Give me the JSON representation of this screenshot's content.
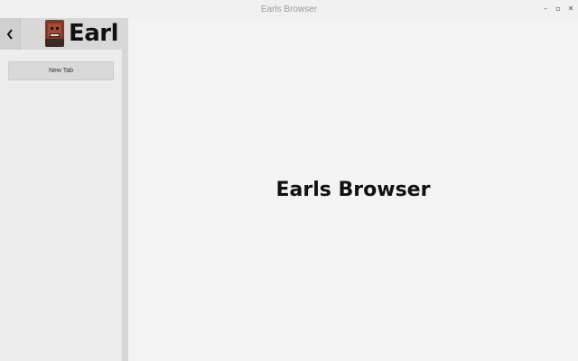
{
  "window": {
    "title": "Earls Browser",
    "controls": {
      "minimize": "–",
      "maximize": "▫",
      "close": "✕"
    }
  },
  "sidebar": {
    "user_name": "Earl",
    "back_icon": "chevron-left-icon",
    "new_tab_label": "New Tab"
  },
  "main": {
    "heading": "Earls Browser"
  }
}
